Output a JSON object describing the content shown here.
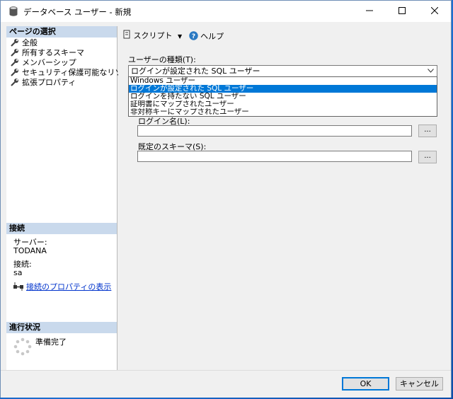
{
  "window": {
    "title": "データベース ユーザー - 新規"
  },
  "left_pane": {
    "select_page_header": "ページの選択",
    "pages": [
      "全般",
      "所有するスキーマ",
      "メンバーシップ",
      "セキュリティ保護可能なリソース",
      "拡張プロパティ"
    ],
    "connection_header": "接続",
    "server_label": "サーバー:",
    "server_value": "TODANA",
    "connection_label": "接続:",
    "connection_value": "sa",
    "view_properties_link": "接続のプロパティの表示",
    "progress_header": "進行状況",
    "progress_status": "準備完了"
  },
  "toolbar": {
    "script_label": "スクリプト",
    "help_label": "ヘルプ"
  },
  "form": {
    "user_type_label": "ユーザーの種類(T):",
    "user_type_value": "ログインが設定された SQL ユーザー",
    "user_type_options": [
      "Windows ユーザー",
      "ログインが設定された SQL ユーザー",
      "ログインを持たない SQL ユーザー",
      "証明書にマップされたユーザー",
      "非対称キーにマップされたユーザー"
    ],
    "selected_option_index": 1,
    "login_name_label": "ログイン名(L):",
    "default_schema_label": "既定のスキーマ(S):",
    "ellipsis_label": "..."
  },
  "buttons": {
    "ok": "OK",
    "cancel": "キャンセル"
  }
}
